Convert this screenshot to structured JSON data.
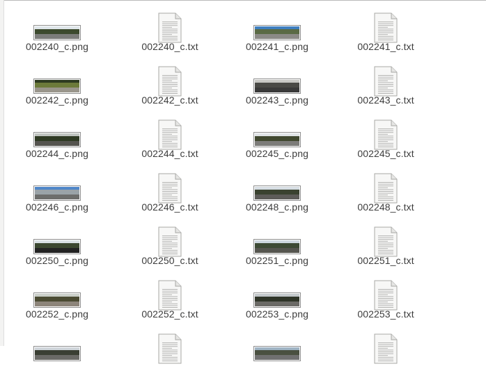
{
  "files": [
    {
      "name": "002240_c.png",
      "kind": "image",
      "palette": {
        "sky": "#dfe6ea",
        "trees": "#3c4a2e",
        "road": "#7b7c7a"
      }
    },
    {
      "name": "002240_c.txt",
      "kind": "text"
    },
    {
      "name": "002241_c.png",
      "kind": "image",
      "palette": {
        "sky": "#3f7fc0",
        "trees": "#5a6a45",
        "road": "#8b8a86"
      }
    },
    {
      "name": "002241_c.txt",
      "kind": "text"
    },
    {
      "name": "002242_c.png",
      "kind": "image",
      "palette": {
        "sky": "#2d3a20",
        "trees": "#6c7a3a",
        "road": "#9a968c"
      }
    },
    {
      "name": "002242_c.txt",
      "kind": "text"
    },
    {
      "name": "002243_c.png",
      "kind": "image",
      "palette": {
        "sky": "#c8c8c4",
        "trees": "#4a4a46",
        "road": "#3a3a3a"
      }
    },
    {
      "name": "002243_c.txt",
      "kind": "text"
    },
    {
      "name": "002244_c.png",
      "kind": "image",
      "palette": {
        "sky": "#bfc4c0",
        "trees": "#2f3a24",
        "road": "#55544f"
      }
    },
    {
      "name": "002244_c.txt",
      "kind": "text"
    },
    {
      "name": "002245_c.png",
      "kind": "image",
      "palette": {
        "sky": "#dfe3e6",
        "trees": "#40482f",
        "road": "#7c7c79"
      }
    },
    {
      "name": "002245_c.txt",
      "kind": "text"
    },
    {
      "name": "002246_c.png",
      "kind": "image",
      "palette": {
        "sky": "#4f86c8",
        "trees": "#9aa3a8",
        "road": "#6d6e6c"
      }
    },
    {
      "name": "002246_c.txt",
      "kind": "text"
    },
    {
      "name": "002248_c.png",
      "kind": "image",
      "palette": {
        "sky": "#d6dde3",
        "trees": "#3a4230",
        "road": "#5d5c59"
      }
    },
    {
      "name": "002248_c.txt",
      "kind": "text"
    },
    {
      "name": "002250_c.png",
      "kind": "image",
      "palette": {
        "sky": "#d9e0e4",
        "trees": "#3b4730",
        "road": "#222222"
      }
    },
    {
      "name": "002250_c.txt",
      "kind": "text"
    },
    {
      "name": "002251_c.png",
      "kind": "image",
      "palette": {
        "sky": "#cdd7df",
        "trees": "#3d4a35",
        "road": "#55554f"
      }
    },
    {
      "name": "002251_c.txt",
      "kind": "text"
    },
    {
      "name": "002252_c.png",
      "kind": "image",
      "palette": {
        "sky": "#c9cec8",
        "trees": "#4b4b33",
        "road": "#8d857a"
      }
    },
    {
      "name": "002252_c.txt",
      "kind": "text"
    },
    {
      "name": "002253_c.png",
      "kind": "image",
      "palette": {
        "sky": "#c2c7ca",
        "trees": "#2f3528",
        "road": "#6b6a66"
      }
    },
    {
      "name": "002253_c.txt",
      "kind": "text"
    },
    {
      "name": "",
      "kind": "image",
      "palette": {
        "sky": "#cfd5da",
        "trees": "#3a3f33",
        "road": "#6a6a66"
      }
    },
    {
      "name": "",
      "kind": "text"
    },
    {
      "name": "",
      "kind": "image",
      "palette": {
        "sky": "#9fb3c4",
        "trees": "#4a5040",
        "road": "#707070"
      }
    },
    {
      "name": "",
      "kind": "text"
    }
  ]
}
